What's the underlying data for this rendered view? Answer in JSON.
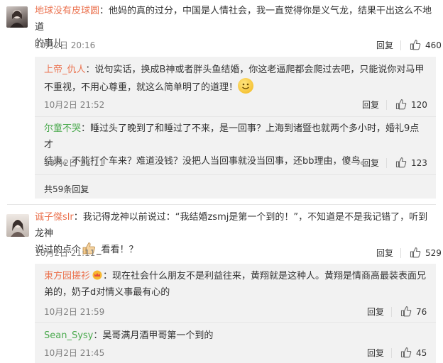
{
  "comments": [
    {
      "username": "地球没有皮球圆",
      "text1": "：他妈的真的过分，中国是人情社会，我一直觉得你是义气龙，结果干出这么不地道",
      "text2": "的事儿",
      "date": "10月2日 20:16",
      "reply_label": "回复",
      "likes": "460",
      "replies": [
        {
          "username": "上帝_仇人",
          "text1": "：说句实话，换成B神或者胖头鱼结婚，你这老逼爬都会爬过去吧，只能说你对马甲",
          "text2": "不重视，不用心尊重，就这么简单明了的道理！",
          "date": "10月2日 21:52",
          "reply_label": "回复",
          "likes": "120"
        },
        {
          "username": "尔童不哭",
          "text1": "：睡过头了晚到了和睡过了不来，是一回事？上海到诸暨也就两个多小时，婚礼9点才",
          "text2": "结束。不能打个车来？难道没钱？没把人当回事就没当回事，还bb理由，傻鸟。",
          "date": "10月2日 21:11",
          "reply_label": "回复",
          "likes": "123"
        }
      ],
      "more_replies": "共59条回复"
    },
    {
      "username": "诚子傑slr",
      "text1": "：我记得龙神以前说过：“我结婚zsmj是第一个到的！”，不知道是不是我记错了，听到龙神",
      "text2a": "说过的点个",
      "text2b": "_看看！？",
      "date": "10月2日 21:11",
      "reply_label": "回复",
      "likes": "529",
      "replies": [
        {
          "username": "東方园搓衫",
          "text1": "：现在社会什么朋友不是利益往来，黄翔就是这种人。黄翔是情商高最装表面兄",
          "text2": "弟的，奶子d对情义事最有心的",
          "date": "10月2日 21:59",
          "reply_label": "回复",
          "likes": "76"
        },
        {
          "username": "Sean_Sysy",
          "text1": "：昊哥满月酒甲哥第一个到的",
          "date": "10月2日 21:45",
          "reply_label": "回复",
          "likes": "45"
        }
      ]
    }
  ]
}
